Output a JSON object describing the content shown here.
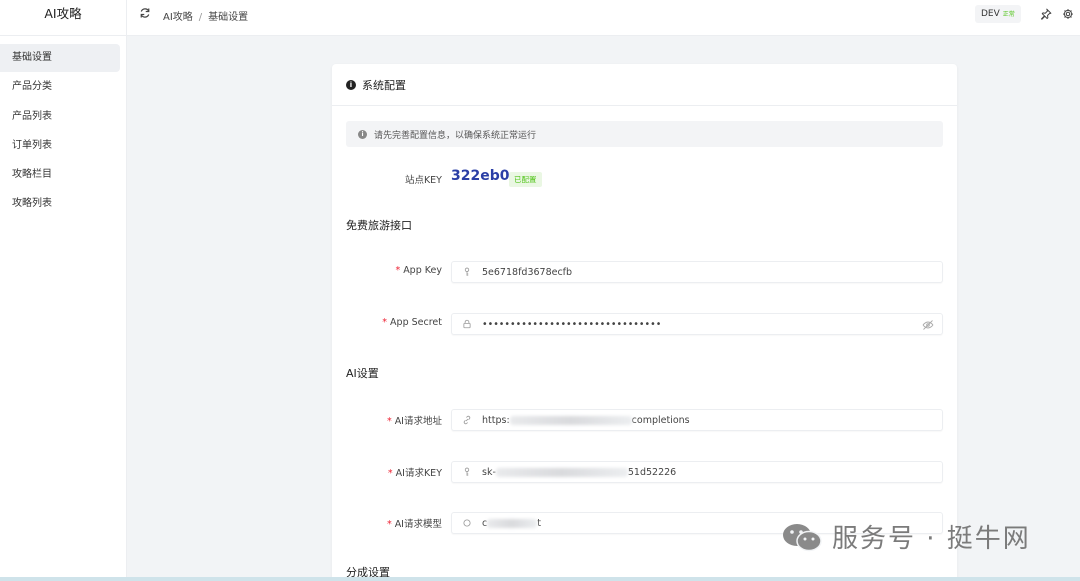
{
  "app": {
    "title": "AI攻略"
  },
  "sidebar": {
    "items": [
      {
        "label": "基础设置",
        "active": true
      },
      {
        "label": "产品分类"
      },
      {
        "label": "产品列表"
      },
      {
        "label": "订单列表"
      },
      {
        "label": "攻略栏目"
      },
      {
        "label": "攻略列表"
      }
    ]
  },
  "header": {
    "breadcrumb": [
      "AI攻略",
      "基础设置"
    ],
    "separator": "/",
    "env": "DEV",
    "env_status": "正常",
    "env_status_color": "#52c41a",
    "icons": [
      "refresh-icon",
      "pin-icon",
      "gear-icon"
    ]
  },
  "card": {
    "title": "系统配置",
    "alert": "请先完善配置信息，以确保系统正常运行",
    "site_key_label": "站点KEY",
    "site_key_value": "322eb0",
    "site_key_color": "#2b3fa6",
    "site_key_status": "已配置",
    "sections": {
      "travel": "免费旅游接口",
      "ai": "AI设置",
      "split": "分成设置"
    },
    "fields": {
      "app_key": {
        "label": "App Key",
        "value": "5e6718fd3678ecfb",
        "icon": "key-icon"
      },
      "app_secret": {
        "label": "App Secret",
        "value": "••••••••••••••••••••••••••••••••",
        "icon": "lock-icon",
        "suffix_icon": "eye-off-icon"
      },
      "ai_url": {
        "label": "AI请求地址",
        "value_prefix": "https:",
        "value_suffix": "completions",
        "icon": "link-icon"
      },
      "ai_key": {
        "label": "AI请求KEY",
        "value_prefix": "sk-",
        "value_suffix": "51d52226",
        "icon": "key-icon"
      },
      "ai_model": {
        "label": "AI请求模型",
        "value_prefix": "c",
        "value_suffix": "t",
        "icon": "circle-icon"
      }
    }
  },
  "watermark": {
    "text": "服务号 · 挺牛网"
  }
}
